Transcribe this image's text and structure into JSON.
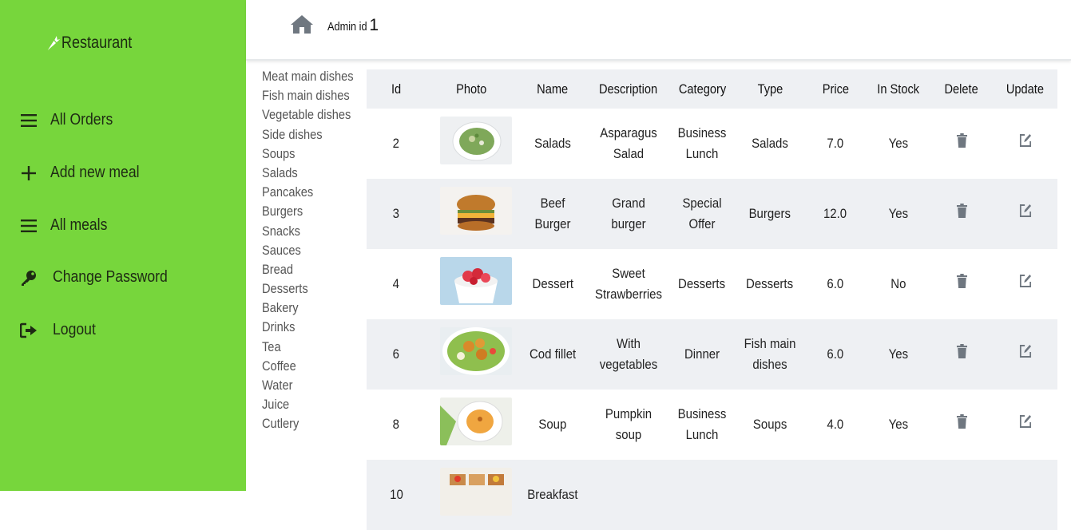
{
  "sidebar": {
    "brand": "Restaurant",
    "items": [
      {
        "label": "All Orders",
        "icon": "bars-icon"
      },
      {
        "label": "Add new meal",
        "icon": "plus-icon"
      },
      {
        "label": "All meals",
        "icon": "bars-icon"
      },
      {
        "label": "Change Password",
        "icon": "key-icon"
      },
      {
        "label": "Logout",
        "icon": "logout-icon"
      }
    ]
  },
  "header": {
    "admin_label": "Admin id",
    "admin_id": "1"
  },
  "categories": [
    "Meat main dishes",
    "Fish main dishes",
    "Vegetable dishes",
    "Side dishes",
    "Soups",
    "Salads",
    "Pancakes",
    "Burgers",
    "Snacks",
    "Sauces",
    "Bread",
    "Desserts",
    "Bakery",
    "Drinks",
    "Tea",
    "Coffee",
    "Water",
    "Juice",
    "Cutlery"
  ],
  "table": {
    "headers": [
      "Id",
      "Photo",
      "Name",
      "Description",
      "Category",
      "Type",
      "Price",
      "In Stock",
      "Delete",
      "Update"
    ],
    "rows": [
      {
        "id": "2",
        "name": "Salads",
        "description": "Asparagus Salad",
        "category": "Business Lunch",
        "type": "Salads",
        "price": "7.0",
        "in_stock": "Yes"
      },
      {
        "id": "3",
        "name": "Beef Burger",
        "description": "Grand burger",
        "category": "Special Offer",
        "type": "Burgers",
        "price": "12.0",
        "in_stock": "Yes"
      },
      {
        "id": "4",
        "name": "Dessert",
        "description": "Sweet Strawberries",
        "category": "Desserts",
        "type": "Desserts",
        "price": "6.0",
        "in_stock": "No"
      },
      {
        "id": "6",
        "name": "Cod fillet",
        "description": "With vegetables",
        "category": "Dinner",
        "type": "Fish main dishes",
        "price": "6.0",
        "in_stock": "Yes"
      },
      {
        "id": "8",
        "name": "Soup",
        "description": "Pumpkin soup",
        "category": "Business Lunch",
        "type": "Soups",
        "price": "4.0",
        "in_stock": "Yes"
      },
      {
        "id": "10",
        "name": "Breakfast",
        "description": "",
        "category": "",
        "type": "",
        "price": "",
        "in_stock": ""
      }
    ]
  },
  "colors": {
    "sidebar": "#77d63c",
    "stripe": "#eef0f3",
    "icon_gray": "#6f7780"
  }
}
